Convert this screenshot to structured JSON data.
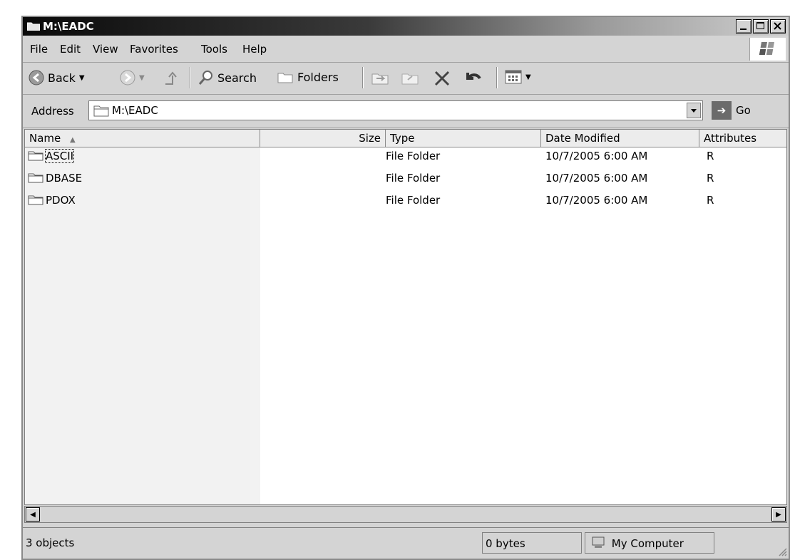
{
  "window": {
    "title": "M:\\EADC"
  },
  "menu": [
    "File",
    "Edit",
    "View",
    "Favorites",
    "Tools",
    "Help"
  ],
  "toolbar": {
    "back": "Back",
    "search": "Search",
    "folders": "Folders"
  },
  "address": {
    "label": "Address",
    "value": "M:\\EADC",
    "go": "Go"
  },
  "columns": {
    "name": "Name",
    "size": "Size",
    "type": "Type",
    "date": "Date Modified",
    "attributes": "Attributes"
  },
  "files": [
    {
      "name": "ASCII",
      "size": "",
      "type": "File Folder",
      "date": "10/7/2005 6:00 AM",
      "attributes": "R"
    },
    {
      "name": "DBASE",
      "size": "",
      "type": "File Folder",
      "date": "10/7/2005 6:00 AM",
      "attributes": "R"
    },
    {
      "name": "PDOX",
      "size": "",
      "type": "File Folder",
      "date": "10/7/2005 6:00 AM",
      "attributes": "R"
    }
  ],
  "status": {
    "objects": "3 objects",
    "size": "0 bytes",
    "location": "My Computer"
  }
}
